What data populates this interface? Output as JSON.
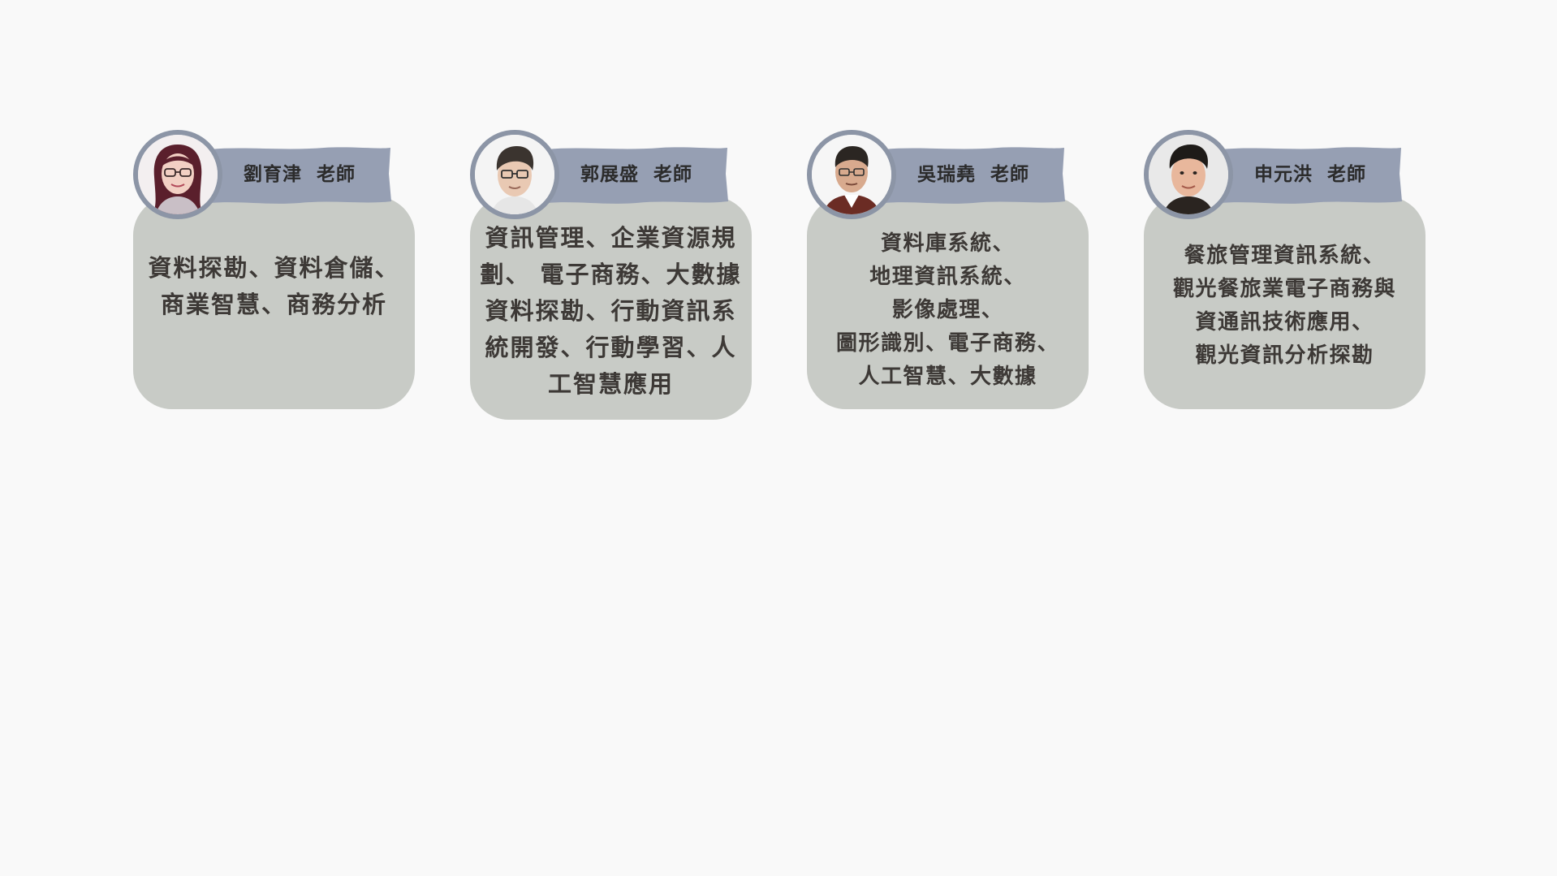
{
  "teachers": [
    {
      "name": "劉育津  老師",
      "specialty": "資料探勘、資料倉儲、\n商業智慧、商務分析",
      "colors": {
        "hair": "#5a1f2c",
        "skin": "#f2d0c4",
        "clothing": "#c9bfc6",
        "background": "#f3eff0"
      }
    },
    {
      "name": "郭展盛  老師",
      "specialty": "資訊管理、企業資源規劃、 電子商務、大數據資料探勘、行動資訊系統開發、行動學習、人工智慧應用",
      "colors": {
        "hair": "#3b342f",
        "skin": "#e9c9b3",
        "clothing": "#e6e6e6",
        "background": "#f4f4f4"
      }
    },
    {
      "name": "吳瑞堯  老師",
      "specialty": "資料庫系統、\n地理資訊系統、\n影像處理、\n圖形識別、電子商務、\n人工智慧、大數據",
      "colors": {
        "hair": "#2b2622",
        "skin": "#d8aa8e",
        "clothing": "#6b2c24",
        "background": "#f6f6f6"
      }
    },
    {
      "name": "申元洪  老師",
      "specialty": "餐旅管理資訊系統、\n觀光餐旅業電子商務與\n資通訊技術應用、\n觀光資訊分析探勘",
      "colors": {
        "hair": "#1e1b18",
        "skin": "#e8b79c",
        "clothing": "#2a2420",
        "background": "#e9e9e9"
      }
    }
  ],
  "theme": {
    "page_background": "#f9f9f9",
    "card_background": "#c8cbc6",
    "banner_color": "#969fb3",
    "avatar_ring": "#8c95a6",
    "text_color": "#3d3936"
  }
}
